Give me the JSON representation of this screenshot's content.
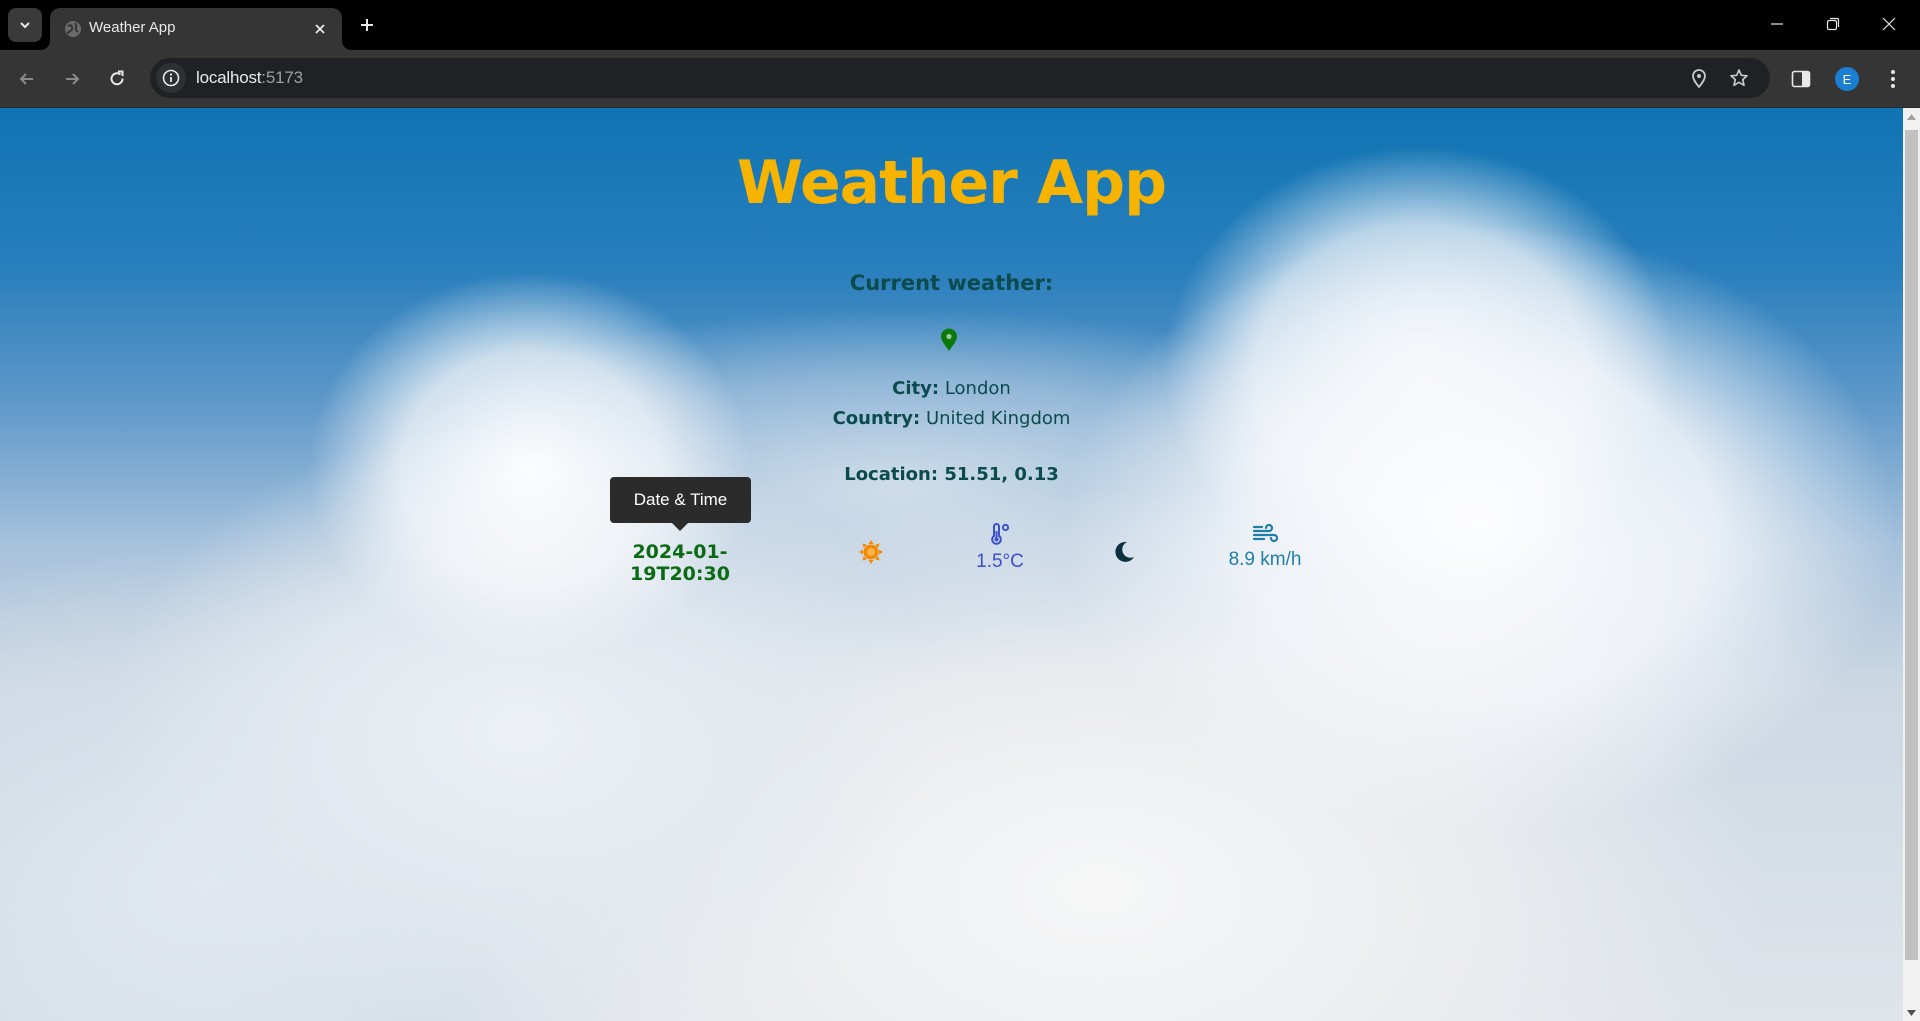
{
  "browser": {
    "tab_title": "Weather App",
    "url_host": "localhost",
    "url_port": ":5173",
    "profile_initial": "E"
  },
  "page": {
    "title": "Weather App",
    "subtitle": "Current weather:",
    "city_label": "City:",
    "city_value": "London",
    "country_label": "Country:",
    "country_value": "United Kingdom",
    "location_label": "Location:",
    "location_value": "51.51, 0.13",
    "tooltip": "Date & Time",
    "datetime": "2024-01-19T20:30",
    "temperature": "1.5°C",
    "wind_speed": "8.9 km/h",
    "icons": {
      "location": "map-pin-icon",
      "sun": "sun-icon",
      "temperature": "thermometer-icon",
      "moon": "moon-icon",
      "wind": "wind-icon"
    }
  },
  "colors": {
    "title": "#f6b300",
    "heading_text": "#0b4b4d",
    "datetime": "#0b6b14",
    "pin": "#0a7a0a",
    "sun": "#f28a00",
    "temperature": "#3d4fc9",
    "moon": "#0b3040",
    "wind": "#1f7ea8"
  }
}
